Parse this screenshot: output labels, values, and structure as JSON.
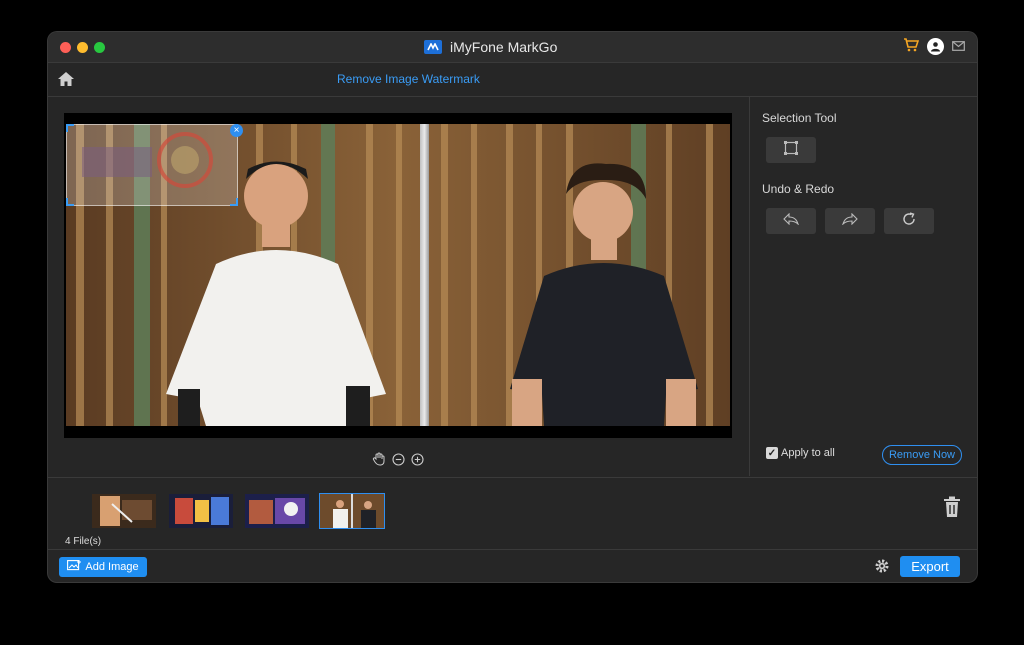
{
  "app": {
    "title": "iMyFone MarkGo"
  },
  "toolbar": {
    "page_title": "Remove Image Watermark"
  },
  "icons": {
    "home": "home-icon",
    "cart": "cart-icon",
    "account": "account-icon",
    "mail": "mail-icon"
  },
  "canvas": {
    "zoom_tools": [
      "pan-hand-icon",
      "zoom-out-icon",
      "zoom-in-icon"
    ]
  },
  "right_panel": {
    "selection_title": "Selection Tool",
    "undo_redo_title": "Undo & Redo",
    "apply_to_all_label": "Apply to all",
    "apply_to_all_checked": true,
    "remove_now_label": "Remove Now"
  },
  "filestrip": {
    "file_count": "4 File(s)",
    "thumbnails": [
      "thumbnail-1",
      "thumbnail-2",
      "thumbnail-3",
      "thumbnail-4"
    ],
    "selected_index": 3
  },
  "bottom": {
    "add_image_label": "Add Image",
    "export_label": "Export"
  },
  "colors": {
    "accent": "#1f8ef1",
    "background": "#262626",
    "text": "#d8d8d8"
  }
}
